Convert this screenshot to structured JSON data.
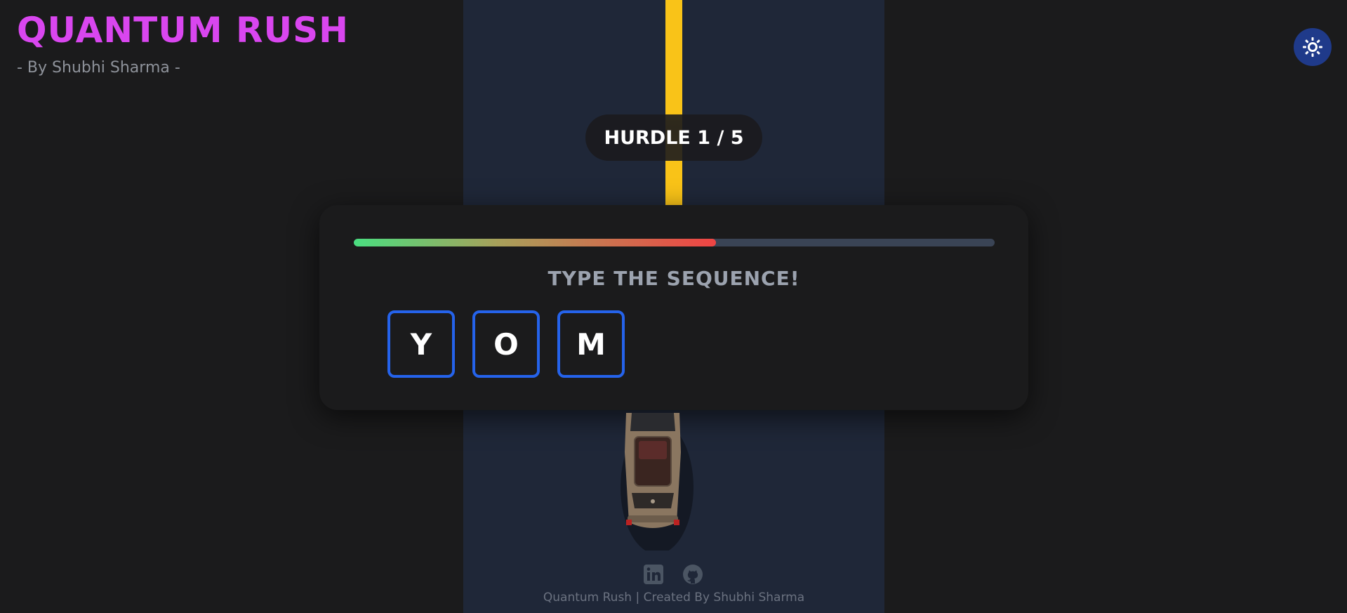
{
  "header": {
    "title": "QUANTUM RUSH",
    "subtitle": "- By Shubhi Sharma -"
  },
  "theme_toggle": {
    "icon": "sun-icon"
  },
  "game": {
    "hurdle_label": "HURDLE 1 / 5",
    "timer_remaining_fraction": 0.565,
    "prompt": "TYPE THE SEQUENCE!",
    "sequence": [
      "Y",
      "O",
      "M"
    ]
  },
  "footer": {
    "icons": [
      "linkedin-icon",
      "github-icon"
    ],
    "text": "Quantum Rush | Created By Shubhi Sharma"
  },
  "colors": {
    "title": "#d946ef",
    "accent_blue": "#2563eb",
    "lane_yellow": "#f9c318",
    "road": "#1f2738",
    "background": "#1b1b1c"
  }
}
